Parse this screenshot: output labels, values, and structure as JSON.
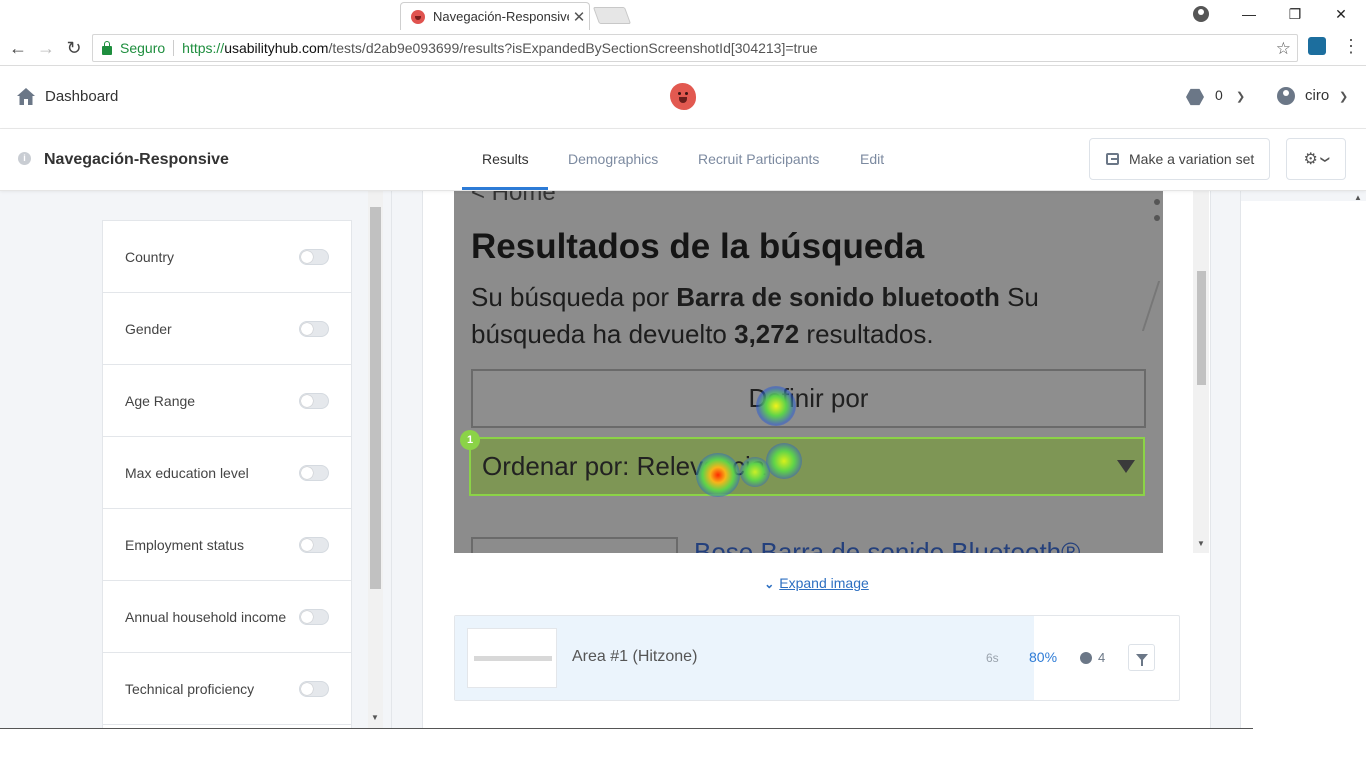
{
  "browser": {
    "tab_title": "Navegación-Responsive",
    "tab_close": "✕",
    "secure_label": "Seguro",
    "url_scheme": "https://",
    "url_domain": "usabilityhub.com",
    "url_path": "/tests/d2ab9e093699/results?isExpandedBySectionScreenshotId[304213]=true"
  },
  "header": {
    "dashboard_label": "Dashboard",
    "credits_count": "0",
    "user_name": "ciro"
  },
  "subheader": {
    "test_name": "Navegación-Responsive",
    "tabs": [
      "Results",
      "Demographics",
      "Recruit Participants",
      "Edit"
    ],
    "active_tab": "Results",
    "variation_button": "Make a variation set"
  },
  "filters": [
    {
      "label": "Country",
      "on": false
    },
    {
      "label": "Gender",
      "on": false
    },
    {
      "label": "Age Range",
      "on": false
    },
    {
      "label": "Max education level",
      "on": false
    },
    {
      "label": "Employment status",
      "on": false
    },
    {
      "label": "Annual household income",
      "on": false
    },
    {
      "label": "Technical proficiency",
      "on": false
    }
  ],
  "screenshot": {
    "home_link": "< Home",
    "heading": "Resultados de la búsqueda",
    "para_1": "Su búsqueda por ",
    "para_bold_1": "Barra de sonido bluetooth",
    "para_2": " Su búsqueda ha devuelto ",
    "para_bold_2": "3,272",
    "para_3": " resultados.",
    "define_button": "Definir por",
    "sort_label": "Ordenar por: Relevancia",
    "hitzone_number": "1",
    "product_link": "Bose Barra de sonido Bluetooth®"
  },
  "expand_label": "Expand image",
  "area": {
    "name": "Area #1 (Hitzone)",
    "time": "6s",
    "percent": "80%",
    "percent_value": 0.8,
    "participants": "4"
  },
  "colors": {
    "accent": "#2d7bd6",
    "hitzone": "#8bd347",
    "logo": "#e25950"
  }
}
